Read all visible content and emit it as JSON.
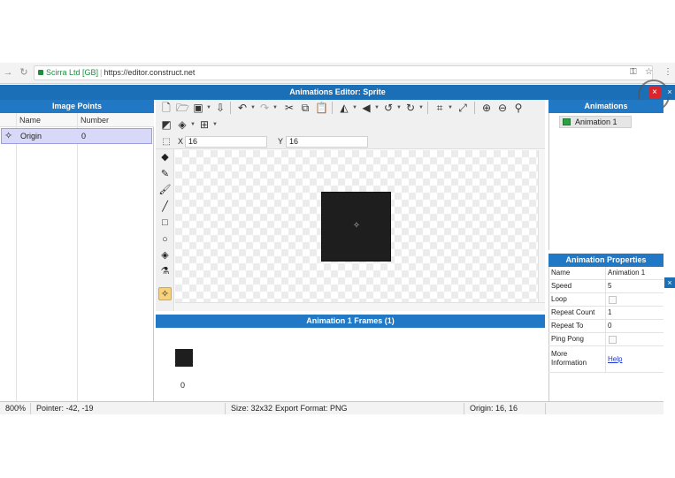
{
  "browser": {
    "url_secure_label": "Scirra Ltd [GB]",
    "url_separator": "|",
    "url": "https://editor.construct.net"
  },
  "editor": {
    "title": "Animations Editor: Sprite",
    "close_label": "×"
  },
  "image_points": {
    "header": "Image Points",
    "columns": [
      "Name",
      "Number"
    ],
    "rows": [
      {
        "name": "Origin",
        "number": "0"
      }
    ]
  },
  "coords": {
    "x_label": "X",
    "x_value": "16",
    "y_label": "Y",
    "y_value": "16"
  },
  "frames": {
    "header": "Animation 1 Frames (1)",
    "items": [
      {
        "number": "0"
      }
    ]
  },
  "animations": {
    "header": "Animations",
    "items": [
      {
        "label": "Animation 1"
      }
    ]
  },
  "properties": {
    "header": "Animation Properties",
    "rows": [
      {
        "name": "Name",
        "value": "Animation 1"
      },
      {
        "name": "Speed",
        "value": "5"
      },
      {
        "name": "Loop",
        "value": ""
      },
      {
        "name": "Repeat Count",
        "value": "1"
      },
      {
        "name": "Repeat To",
        "value": "0"
      },
      {
        "name": "Ping Pong",
        "value": ""
      },
      {
        "name": "More Information",
        "value": "Help"
      }
    ],
    "more_info_line1": "More",
    "more_info_line2": "Information"
  },
  "status": {
    "zoom": "800%",
    "pointer": "Pointer: -42, -19",
    "size": "Size: 32x32",
    "export": "Export Format: PNG",
    "origin": "Origin: 16, 16"
  },
  "colors": {
    "title_bar": "#1a6fb7",
    "panel_header": "#2178c4",
    "selected_row": "#d8d8f8",
    "close_button": "#d9262c",
    "animation_icon": "#2ea043"
  }
}
